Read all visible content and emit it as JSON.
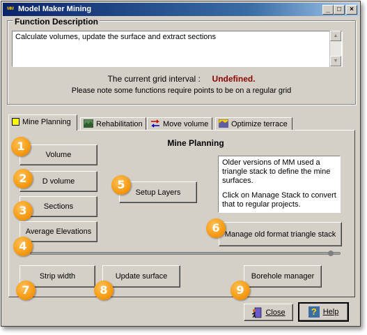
{
  "window": {
    "title": "Model Maker Mining",
    "app_icon": "MM",
    "controls": {
      "minimize": "_",
      "maximize": "□",
      "close": "×"
    }
  },
  "function_description": {
    "label": "Function Description",
    "text": "Calculate volumes, update the surface and extract sections",
    "grid_interval_label": "The current grid interval :",
    "grid_interval_value": "Undefined.",
    "grid_interval_color": "#8b0000",
    "note": "Please note some functions require points to be on a regular grid"
  },
  "tabs": [
    {
      "label": "Mine Planning",
      "icon": "yellow-square-icon",
      "active": true
    },
    {
      "label": "Rehabilitation",
      "icon": "landscape-icon",
      "active": false
    },
    {
      "label": "Move volume",
      "icon": "arrows-icon",
      "active": false
    },
    {
      "label": "Optimize terrace",
      "icon": "terrace-icon",
      "active": false
    }
  ],
  "panel": {
    "title": "Mine Planning",
    "buttons": {
      "volume": "Volume",
      "d_volume": "D volume",
      "sections": "Sections",
      "average_elevations": "Average Elevations",
      "setup_layers": "Setup Layers",
      "manage_triangle_stack": "Manage old format triangle stack",
      "strip_width": "Strip width",
      "update_surface": "Update surface",
      "borehole_manager": "Borehole manager"
    },
    "info_text_1": "Older versions of MM used a triangle stack to define the mine surfaces.",
    "info_text_2": "Click on Manage Stack to convert that to regular projects."
  },
  "badges": [
    "1",
    "2",
    "3",
    "4",
    "5",
    "6",
    "7",
    "8",
    "9"
  ],
  "badge_color": "#f59a12",
  "footer": {
    "close_label": "Close",
    "help_label": "Help"
  }
}
